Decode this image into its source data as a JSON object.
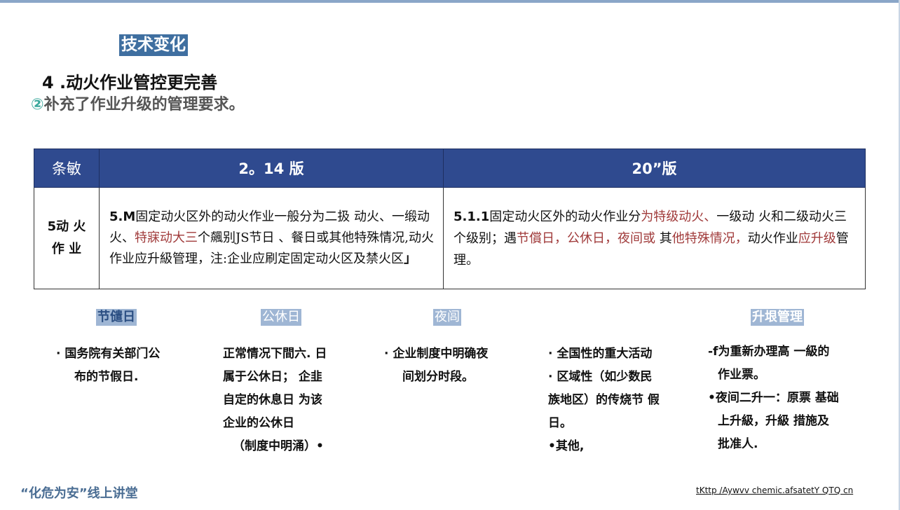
{
  "tag": "技术变化",
  "heading": "4 .动火作业管控更完善",
  "subheading": {
    "marker": "②",
    "text": "补充了作业升级的管理要求。"
  },
  "table": {
    "headers": [
      "条敏",
      "2。14 版",
      "20”版"
    ],
    "row": {
      "clause_line1": "5动 火",
      "clause_line2": "作 业",
      "old": {
        "seg1": "5.M",
        "seg2": "固定动火区外的动火作业一般分为二扱 动火、一缎动火、",
        "seg3": "特寐动大三",
        "seg4": "个飆别JS节日 、餐日或其他特殊情况,动火作业应升級管理，注:企业应刷定固定动火区及禁火区",
        "seg5": "」"
      },
      "new": {
        "seg1": "5.1.1",
        "seg2": "固定动火区外的动火作业分",
        "seg3": "为特级动火、",
        "seg4": "一级动 火和二级动火三个级别；遇",
        "seg5": "节償日，公休日，夜间或",
        "seg6": " 其",
        "seg7": "他特殊情况，",
        "seg8": "动火作业",
        "seg9": "应升级",
        "seg10": "管理。"
      }
    }
  },
  "categories": [
    "节儙日",
    "公休日",
    "夜闾",
    "升垠管理"
  ],
  "boxes": {
    "b1": [
      "· 国务院有关部门公",
      "布的节假日."
    ],
    "b2": [
      "正常情况下間六. 日",
      "属于公休日；  企韭",
      "自定的休息日 为该",
      "企业的公休日",
      "（制度中明涌）•"
    ],
    "b3": [
      "· 企业制度中明确夜",
      "间划分时段。"
    ],
    "b4": [
      "· 全国性的重大活动",
      "· 区域性（如少数民",
      "族地区）的传烧节 假",
      "日。",
      "•其他,"
    ],
    "b5": [
      "-f为重新办理高 一級的",
      "作业票。",
      "•夜间二升一：原票 基础",
      "上升級，升級 措施及",
      "批准人."
    ]
  },
  "footer": {
    "left": "“化危为安”线上讲堂",
    "right": "tKttp /Aywvv chemic.afsatetY QTQ cn"
  },
  "colors": {
    "header": "#2f4a8f",
    "highlight": "#a03a3a",
    "tag": "#3f6fa0"
  }
}
